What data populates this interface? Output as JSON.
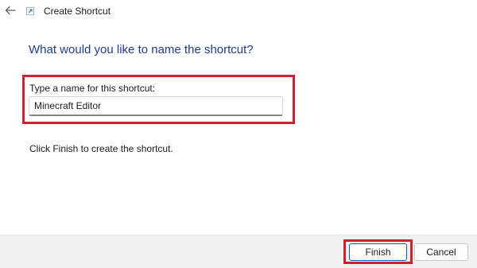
{
  "window": {
    "title": "Create Shortcut"
  },
  "icons": {
    "back": "arrow-left-icon",
    "shortcut": "shortcut-icon"
  },
  "main": {
    "heading": "What would you like to name the shortcut?",
    "field_label": "Type a name for this shortcut:",
    "name_value": "Minecraft Editor",
    "instruction": "Click Finish to create the shortcut."
  },
  "footer": {
    "finish_label": "Finish",
    "cancel_label": "Cancel"
  },
  "colors": {
    "heading": "#1e3d8f",
    "highlight": "#d0202e",
    "footer_bg": "#f0f0f0",
    "accent": "#005fb8"
  }
}
